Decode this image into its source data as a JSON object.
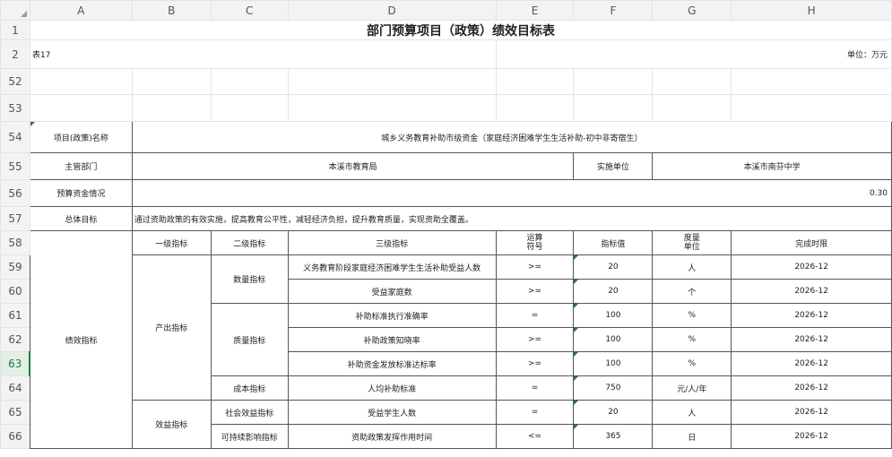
{
  "columns": [
    "A",
    "B",
    "C",
    "D",
    "E",
    "F",
    "G",
    "H"
  ],
  "rows": {
    "r1": "1",
    "r2": "2",
    "r52": "52",
    "r53": "53",
    "r54": "54",
    "r55": "55",
    "r56": "56",
    "r57": "57",
    "r58": "58",
    "r59": "59",
    "r60": "60",
    "r61": "61",
    "r62": "62",
    "r63": "63",
    "r64": "64",
    "r65": "65",
    "r66": "66"
  },
  "sheet": {
    "title": "部门预算项目（政策）绩效目标表",
    "table_no": "表17",
    "unit": "单位：万元",
    "project_label": "项目(政策)名称",
    "project_name": "城乡义务教育补助市级资金（家庭经济困难学生生活补助-初中非寄宿生）",
    "dept_label": "主管部门",
    "dept_value": "本溪市教育局",
    "impl_label": "实施单位",
    "impl_value": "本溪市南芬中学",
    "budget_label": "预算资金情况",
    "budget_value": "0.30",
    "goal_label": "总体目标",
    "goal_value": "通过资助政策的有效实施，提高教育公平性，减轻经济负担，提升教育质量，实现资助全覆盖。",
    "perf_label": "绩效指标",
    "headers": {
      "level1": "一级指标",
      "level2": "二级指标",
      "level3": "三级指标",
      "op_line1": "运算",
      "op_line2": "符号",
      "target": "指标值",
      "unit_line1": "度量",
      "unit_line2": "单位",
      "deadline": "完成时限"
    },
    "output_label": "产出指标",
    "benefit_label": "效益指标",
    "qty_label": "数量指标",
    "quality_label": "质量指标",
    "cost_label": "成本指标",
    "social_label": "社会效益指标",
    "sustain_label": "可持续影响指标",
    "items": [
      {
        "name": "义务教育阶段家庭经济困难学生生活补助受益人数",
        "op": ">=",
        "value": "20",
        "unit": "人",
        "deadline": "2026-12"
      },
      {
        "name": "受益家庭数",
        "op": ">=",
        "value": "20",
        "unit": "个",
        "deadline": "2026-12"
      },
      {
        "name": "补助标准执行准确率",
        "op": "=",
        "value": "100",
        "unit": "%",
        "deadline": "2026-12"
      },
      {
        "name": "补助政策知晓率",
        "op": ">=",
        "value": "100",
        "unit": "%",
        "deadline": "2026-12"
      },
      {
        "name": "补助资金发放标准达标率",
        "op": ">=",
        "value": "100",
        "unit": "%",
        "deadline": "2026-12"
      },
      {
        "name": "人均补助标准",
        "op": "=",
        "value": "750",
        "unit": "元/人/年",
        "deadline": "2026-12"
      },
      {
        "name": "受益学生人数",
        "op": "=",
        "value": "20",
        "unit": "人",
        "deadline": "2026-12"
      },
      {
        "name": "资助政策发挥作用时间",
        "op": "<=",
        "value": "365",
        "unit": "日",
        "deadline": "2026-12"
      }
    ]
  }
}
